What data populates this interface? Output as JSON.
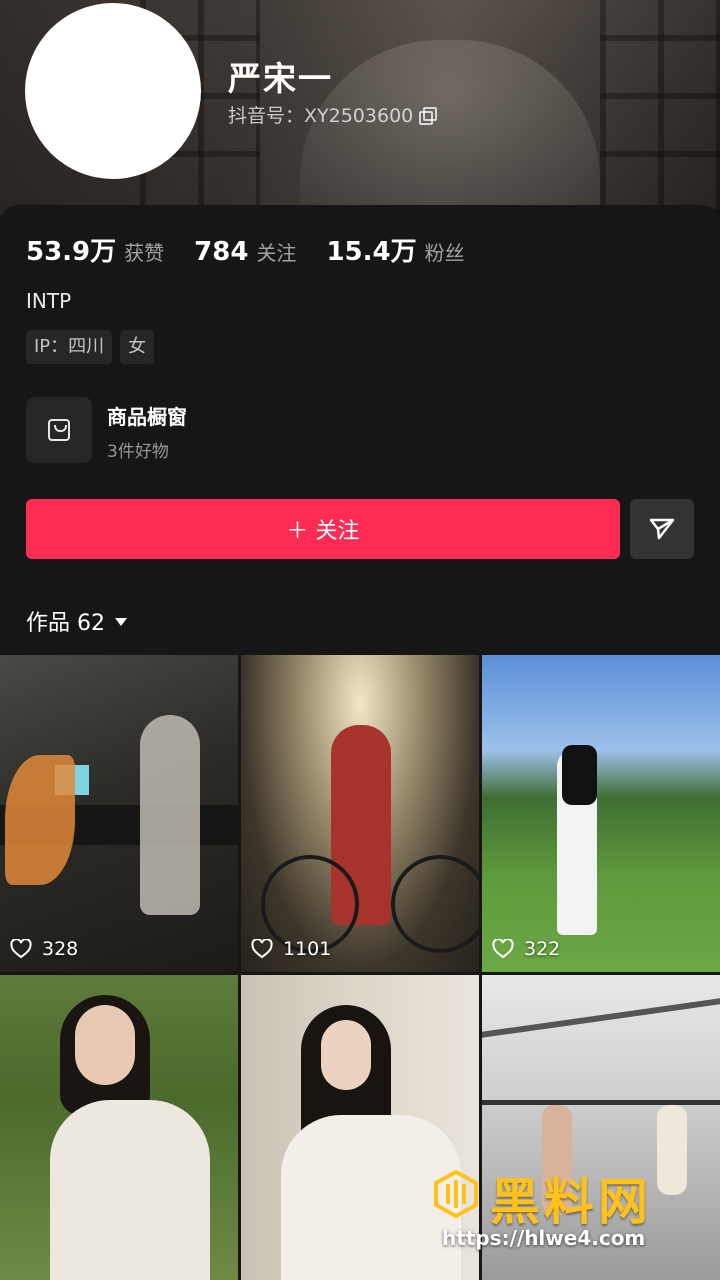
{
  "profile": {
    "name": "严宋一",
    "douyin_id": "抖音号：XY2503600",
    "stats": [
      {
        "value": "53.9万",
        "label": "获赞"
      },
      {
        "value": "784",
        "label": "关注"
      },
      {
        "value": "15.4万",
        "label": "粉丝"
      }
    ],
    "bio": "INTP",
    "tags": [
      "IP：四川",
      "女"
    ]
  },
  "shop": {
    "title": "商品橱窗",
    "subtitle": "3件好物",
    "icon": "shopping-bag-icon"
  },
  "actions": {
    "follow_label": "＋ 关注",
    "share_icon": "send-icon"
  },
  "works_tab": {
    "label": "作品 62"
  },
  "videos": [
    {
      "likes": "328"
    },
    {
      "likes": "1101"
    },
    {
      "likes": "322"
    },
    {
      "likes": ""
    },
    {
      "likes": ""
    },
    {
      "likes": ""
    }
  ],
  "watermark": {
    "text": "黑料网",
    "url": "https://hlwe4.com"
  },
  "colors": {
    "accent": "#fe2c55",
    "background": "#161616",
    "watermark": "#ffc21a"
  }
}
